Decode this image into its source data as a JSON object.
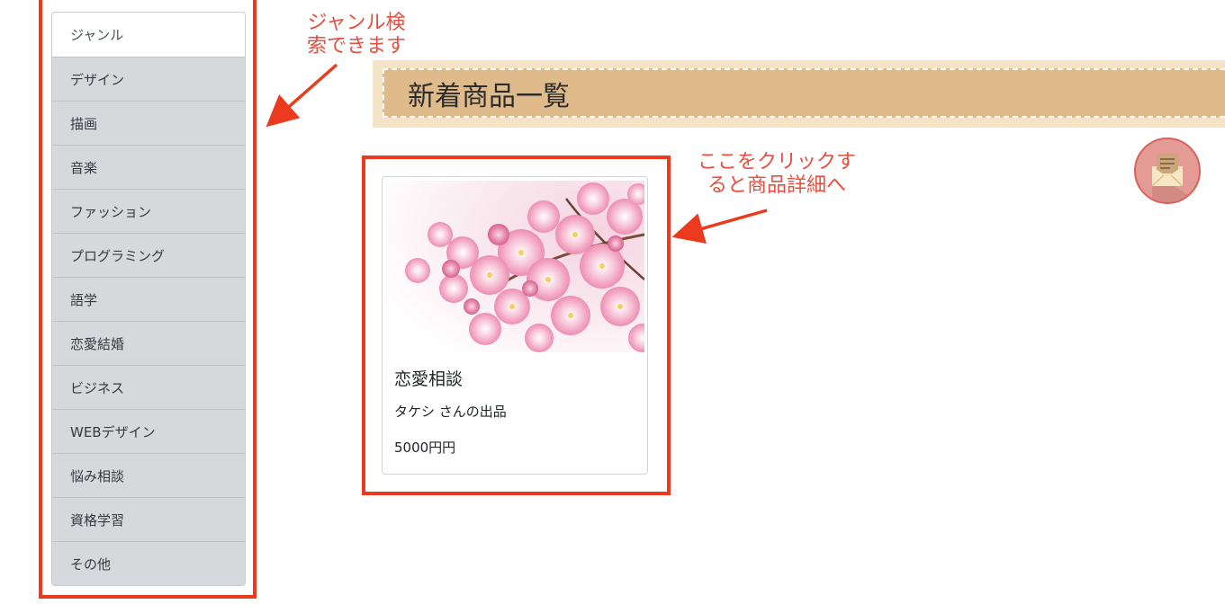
{
  "sidebar": {
    "items": [
      {
        "label": "ジャンル"
      },
      {
        "label": "デザイン"
      },
      {
        "label": "描画"
      },
      {
        "label": "音楽"
      },
      {
        "label": "ファッション"
      },
      {
        "label": "プログラミング"
      },
      {
        "label": "語学"
      },
      {
        "label": "恋愛結婚"
      },
      {
        "label": "ビジネス"
      },
      {
        "label": "WEBデザイン"
      },
      {
        "label": "悩み相談"
      },
      {
        "label": "資格学習"
      },
      {
        "label": "その他"
      }
    ]
  },
  "annotations": {
    "genre_line1": "ジャンル検",
    "genre_line2": "索できます",
    "card_line1": "ここをクリックす",
    "card_line2": "ると商品詳細へ",
    "color": "#ec3a1f"
  },
  "main": {
    "heading": "新着商品一覧",
    "products": [
      {
        "title": "恋愛相談",
        "seller": "タケシ さんの出品",
        "price": "5000円円",
        "image": "cherry-blossom-photo"
      }
    ]
  },
  "header_icon": {
    "name": "mail-icon",
    "color": "#e49a95"
  }
}
